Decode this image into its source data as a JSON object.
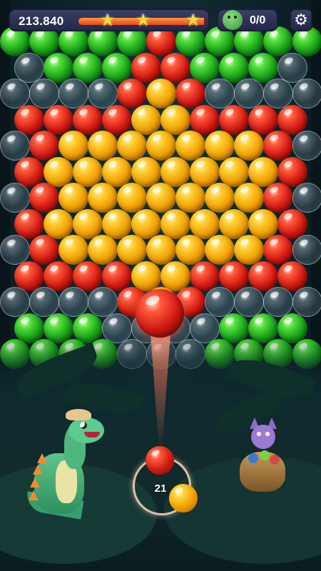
{
  "hud": {
    "score": "213.840",
    "progress_fraction": 0.98,
    "stars_earned": 3,
    "stars_total": 3,
    "dino_counter": "0/0",
    "settings_icon": "gear-icon"
  },
  "board": {
    "palette": {
      "R": "#d11a12",
      "Y": "#f0a000",
      "G": "#18a218",
      "C": "#cfe6f0"
    },
    "rows": [
      {
        "offset": false,
        "cells": "GGGGGRGGGGG"
      },
      {
        "offset": true,
        "cells": "CGGGRRGGGC"
      },
      {
        "offset": false,
        "cells": "CCCCRYRCCCC"
      },
      {
        "offset": true,
        "cells": "RRRRYYRRRR"
      },
      {
        "offset": false,
        "cells": "CRYYYYYYYRC"
      },
      {
        "offset": true,
        "cells": "RYYYYYYYYR"
      },
      {
        "offset": false,
        "cells": "CRYYYYYYYRC"
      },
      {
        "offset": true,
        "cells": "RYYYYYYYYR"
      },
      {
        "offset": false,
        "cells": "CRYYYYYYYRC"
      },
      {
        "offset": true,
        "cells": "RRRRYYRRRR"
      },
      {
        "offset": false,
        "cells": "CCCCRYRCCCC"
      },
      {
        "offset": true,
        "cells": "GGGCCCCGGG"
      },
      {
        "offset": false,
        "cells": "GGGGCCCGGGG"
      }
    ]
  },
  "shooter": {
    "aimed_bubble_color": "red",
    "current_bubble_color": "red",
    "next_bubble_color": "yellow",
    "shots_left": "21"
  },
  "characters": {
    "dino": "green dinosaur with hat",
    "helper": "purple bat with bag of bubbles"
  }
}
